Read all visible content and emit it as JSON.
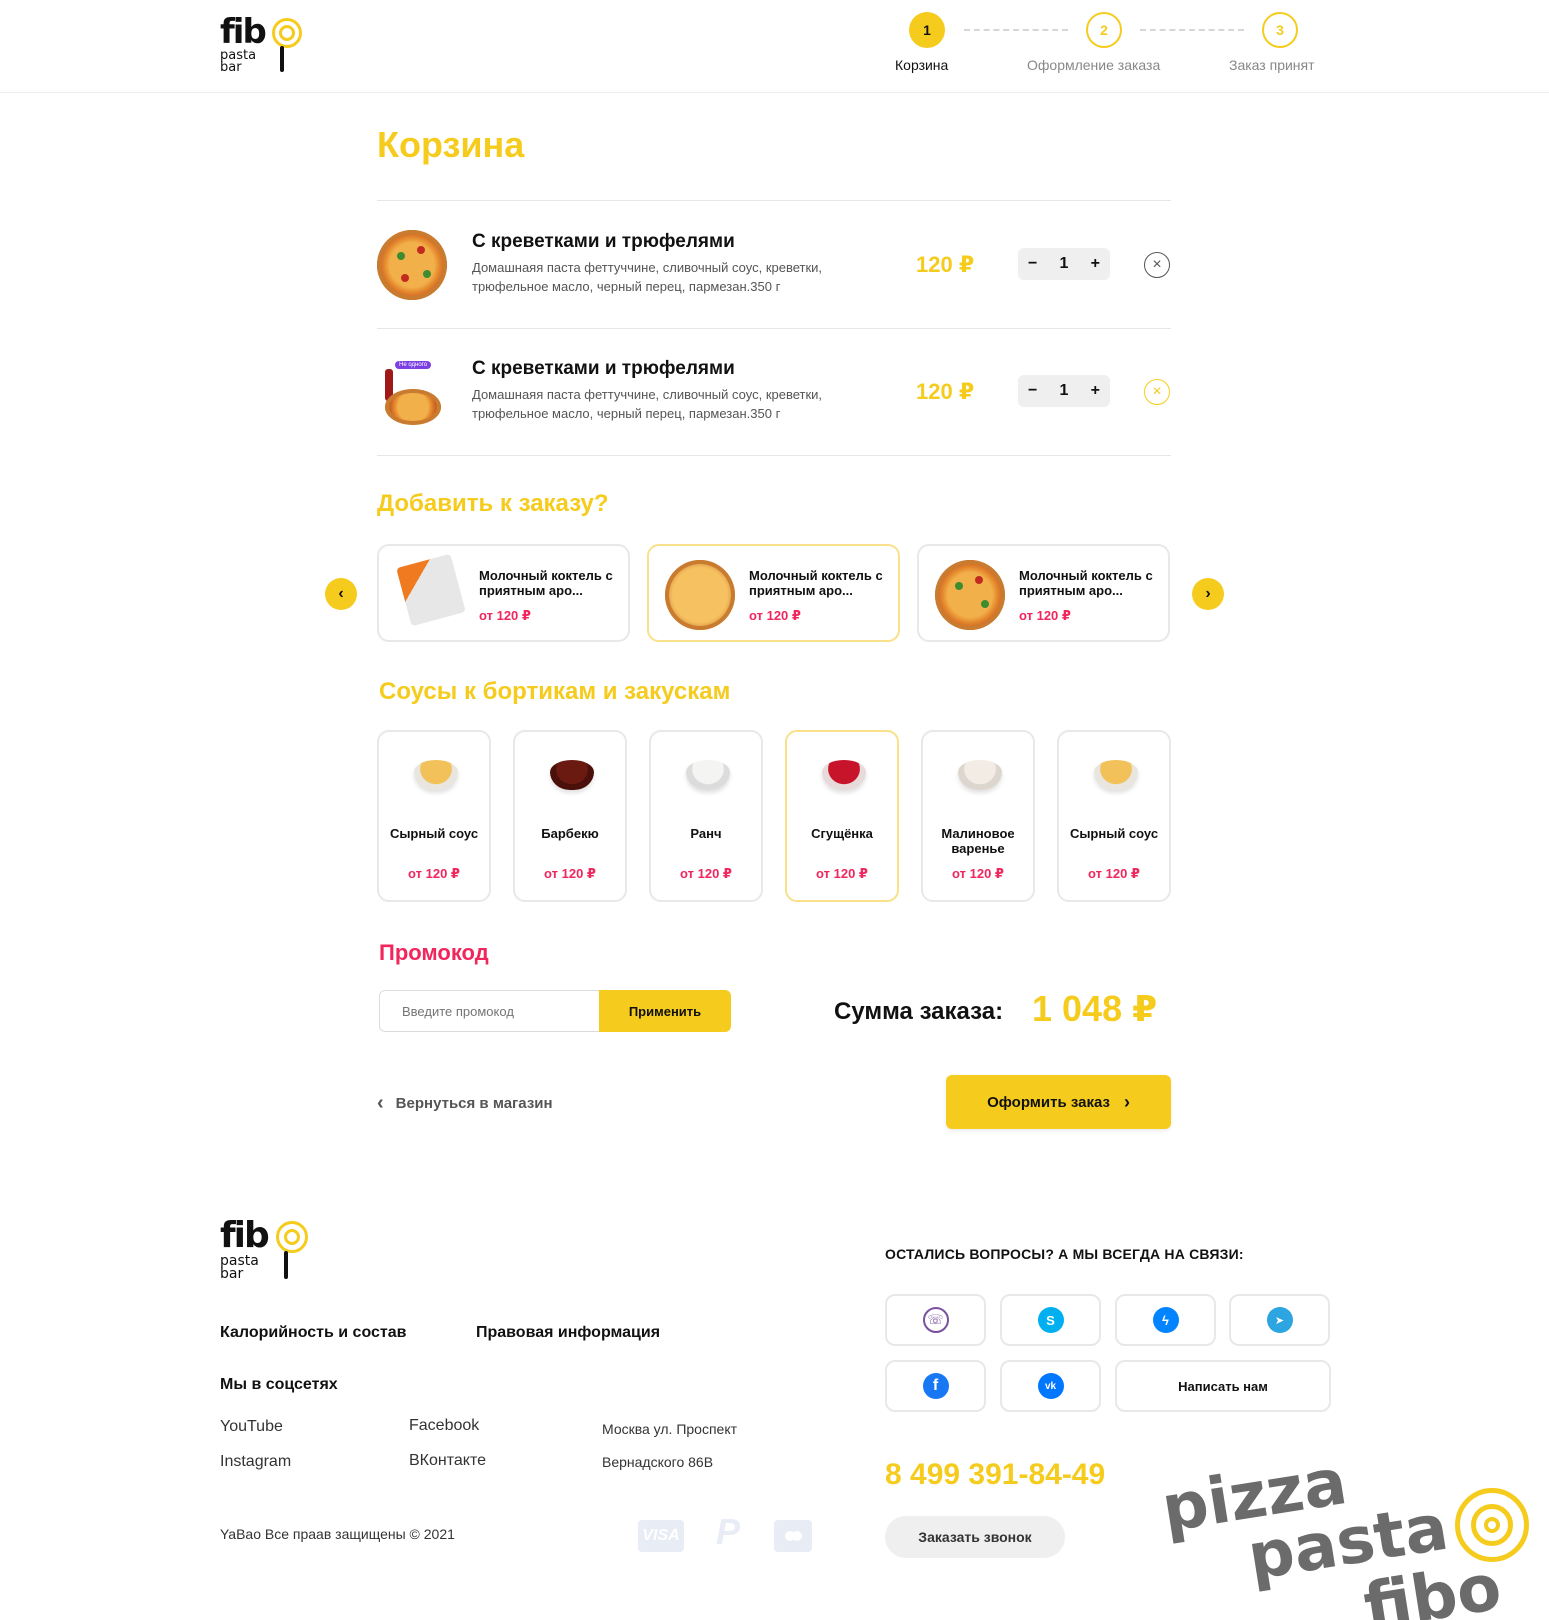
{
  "header": {
    "logo": {
      "word": "fib",
      "sub1": "pasta",
      "sub2": "bar"
    },
    "steps": [
      {
        "num": "1",
        "label": "Корзина",
        "active": true
      },
      {
        "num": "2",
        "label": "Оформление заказа",
        "active": false
      },
      {
        "num": "3",
        "label": "Заказ принят",
        "active": false
      }
    ]
  },
  "cart": {
    "title": "Корзина",
    "items": [
      {
        "name": "С креветками и трюфелями",
        "desc": "Домашнаяя паста феттуччине, сливочный соус, креветки, трюфельное масло, черный перец, пармезан.350 г",
        "price": "120 ₽",
        "qty": "1",
        "minus": "−",
        "plus": "+",
        "remove": "×"
      },
      {
        "name": "С креветками и трюфелями",
        "desc": "Домашнаяя паста феттуччине, сливочный соус, креветки, трюфельное масло, черный перец, пармезан.350 г",
        "price": "120 ₽",
        "qty": "1",
        "minus": "−",
        "plus": "+",
        "remove": "×",
        "badge": "Не одного"
      }
    ]
  },
  "addons": {
    "title": "Добавить к заказу?",
    "prev": "‹",
    "next": "›",
    "items": [
      {
        "name": "Молочный коктель с приятным аро...",
        "price": "от 120 ₽"
      },
      {
        "name": "Молочный коктель с приятным аро...",
        "price": "от 120 ₽"
      },
      {
        "name": "Молочный коктель с приятным аро...",
        "price": "от 120 ₽"
      }
    ]
  },
  "sauces": {
    "title": "Соусы к бортикам и закускам",
    "items": [
      {
        "name": "Сырный соус",
        "price": "от 120 ₽",
        "color": "#f3c15a"
      },
      {
        "name": "Барбекю",
        "price": "от 120 ₽",
        "color": "#6b1a12"
      },
      {
        "name": "Ранч",
        "price": "от 120 ₽",
        "color": "#f4f4f2"
      },
      {
        "name": "Сгущёнка",
        "price": "от 120 ₽",
        "color": "#c8142a"
      },
      {
        "name": "Малиновое варенье",
        "price": "от 120 ₽",
        "color": "#f2ece4"
      },
      {
        "name": "Сырный соус",
        "price": "от 120 ₽",
        "color": "#f3c15a"
      }
    ]
  },
  "promo": {
    "title": "Промокод",
    "placeholder": "Введите промокод",
    "apply": "Применить"
  },
  "summary": {
    "label": "Сумма заказа:",
    "value": "1 048 ₽"
  },
  "actions": {
    "back": "Вернуться в магазин",
    "back_icon": "‹",
    "order": "Оформить заказ",
    "order_icon": "›"
  },
  "footer": {
    "links": [
      "Калорийность и состав",
      "Правовая информация"
    ],
    "social_title": "Мы в соцсетях",
    "socials": [
      "YouTube",
      "Facebook",
      "Instagram",
      "ВКонтакте"
    ],
    "address1": "Москва ул. Проспект",
    "address2": "Вернадского 86В",
    "copyright": "YaBao Все праав защищены © 2021",
    "payments": [
      "VISA",
      "P"
    ],
    "contact_title": "ОСТАЛИСЬ ВОПРОСЫ? А МЫ ВСЕГДА НА СВЯЗИ:",
    "messengers": [
      {
        "name": "viber",
        "glyph": "☏",
        "color": "#7b519d"
      },
      {
        "name": "skype",
        "glyph": "S",
        "color": "#00aff0"
      },
      {
        "name": "messenger",
        "glyph": "ϟ",
        "color": "#0084ff"
      },
      {
        "name": "telegram",
        "glyph": "➤",
        "color": "#2ca5e0"
      },
      {
        "name": "facebook",
        "glyph": "f",
        "color": "#1877f2"
      },
      {
        "name": "vk",
        "glyph": "vk",
        "color": "#0077ff"
      }
    ],
    "write_us": "Написать нам",
    "phone": "8 499 391-84-49",
    "callback": "Заказать звонок",
    "brand_lines": [
      "pizza",
      "pasta",
      "fibo"
    ]
  }
}
